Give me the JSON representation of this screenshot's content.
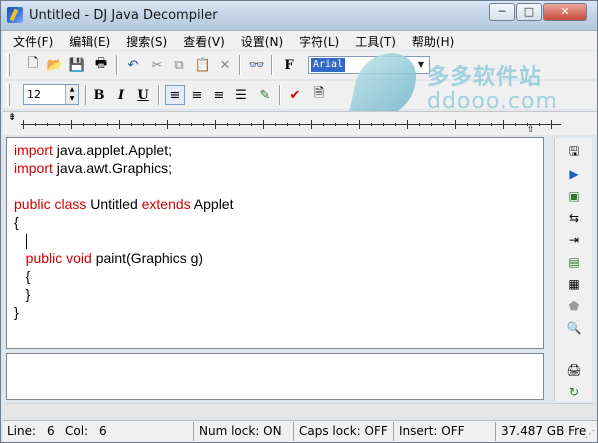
{
  "window": {
    "title": "Untitled - DJ Java Decompiler",
    "minimize": "─",
    "maximize": "□",
    "close": "✕"
  },
  "menu": [
    "文件(F)",
    "编辑(E)",
    "搜索(S)",
    "查看(V)",
    "设置(N)",
    "字符(L)",
    "工具(T)",
    "帮助(H)"
  ],
  "toolbar1": {
    "icons": [
      "new-file-icon",
      "open-folder-icon",
      "save-icon",
      "print-icon",
      "undo-icon",
      "cut-icon",
      "copy-icon",
      "paste-icon",
      "delete-icon",
      "find-icon",
      "font-icon"
    ],
    "glyphs": [
      "🗋",
      "📂",
      "💾",
      "🖶",
      "↶",
      "✂",
      "⧉",
      "📋",
      "✕",
      "👓",
      "F"
    ],
    "font_value": "Arial"
  },
  "toolbar2": {
    "font_size": "12",
    "bold": "B",
    "italic": "I",
    "underline": "U",
    "glyphs": [
      "≡",
      "≡",
      "≡",
      "☰",
      "✎",
      "✔",
      "🗎"
    ]
  },
  "ruler": {
    "marker": "⇟",
    "tab": "⇧"
  },
  "code": [
    [
      {
        "t": "import",
        "k": true
      },
      {
        "t": " java.applet.Applet;",
        "k": false
      }
    ],
    [
      {
        "t": "import",
        "k": true
      },
      {
        "t": " java.awt.Graphics;",
        "k": false
      }
    ],
    [],
    [
      {
        "t": "public class",
        "k": true
      },
      {
        "t": " Untitled ",
        "k": false
      },
      {
        "t": "extends",
        "k": true
      },
      {
        "t": " Applet",
        "k": false
      }
    ],
    [
      {
        "t": "{",
        "k": false
      }
    ],
    [
      {
        "t": "  ",
        "k": false
      }
    ],
    [
      {
        "t": "   ",
        "k": false
      },
      {
        "t": "public void",
        "k": true
      },
      {
        "t": " paint(Graphics g)",
        "k": false
      }
    ],
    [
      {
        "t": "   {",
        "k": false
      }
    ],
    [
      {
        "t": "   }",
        "k": false
      }
    ],
    [
      {
        "t": "}",
        "k": false
      }
    ]
  ],
  "side_icons": [
    "save-icon",
    "play-icon",
    "monitor-icon",
    "convert-icon",
    "export-icon",
    "package-icon",
    "archive-icon",
    "shield-icon",
    "search-icon",
    "printer-icon",
    "refresh-icon"
  ],
  "side_glyphs": [
    "🖫",
    "▶",
    "▣",
    "⇆",
    "⇥",
    "▤",
    "▦",
    "⬟",
    "🔍",
    "🖨",
    "↻"
  ],
  "status": {
    "line_label": "Line:",
    "line": "6",
    "col_label": "Col:",
    "col": "6",
    "num_lock": "Num lock: ON",
    "caps_lock": "Caps lock: OFF",
    "insert": "Insert: OFF",
    "free": "37.487 GB Fre"
  },
  "watermark": {
    "cn": "多多软件站",
    "en": "ddooo.com"
  },
  "colors": {
    "keyword": "#d00000",
    "accent": "#3169c6"
  }
}
